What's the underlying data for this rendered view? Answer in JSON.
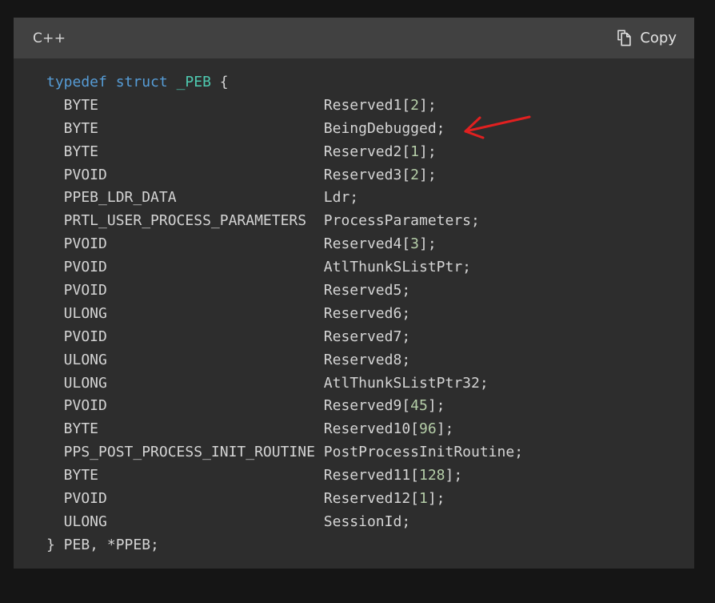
{
  "panel": {
    "language_label": "C++",
    "copy_label": "Copy",
    "copy_icon": "copy-documents-icon"
  },
  "colors": {
    "page_background": "#151515",
    "panel_background": "#2d2d2d",
    "header_background": "#414141",
    "default_text": "#d4d4d4",
    "keyword": "#569cd6",
    "type_name": "#4ec9b0",
    "number": "#b5cea8",
    "annotation_arrow": "#e02020"
  },
  "annotation": {
    "type": "arrow",
    "points_to": "BeingDebugged;",
    "color": "#e02020",
    "direction": "right-to-left"
  },
  "code": {
    "language": "C++",
    "lines": [
      {
        "segments": [
          {
            "t": "typedef ",
            "c": "kw"
          },
          {
            "t": "struct ",
            "c": "kw"
          },
          {
            "t": "_PEB",
            "c": "typ"
          },
          {
            "t": " {",
            "c": "plain"
          }
        ]
      },
      {
        "segments": [
          {
            "t": "  BYTE                          Reserved1[",
            "c": "plain"
          },
          {
            "t": "2",
            "c": "num"
          },
          {
            "t": "];",
            "c": "plain"
          }
        ]
      },
      {
        "segments": [
          {
            "t": "  BYTE                          BeingDebugged;",
            "c": "plain"
          }
        ]
      },
      {
        "segments": [
          {
            "t": "  BYTE                          Reserved2[",
            "c": "plain"
          },
          {
            "t": "1",
            "c": "num"
          },
          {
            "t": "];",
            "c": "plain"
          }
        ]
      },
      {
        "segments": [
          {
            "t": "  PVOID                         Reserved3[",
            "c": "plain"
          },
          {
            "t": "2",
            "c": "num"
          },
          {
            "t": "];",
            "c": "plain"
          }
        ]
      },
      {
        "segments": [
          {
            "t": "  PPEB_LDR_DATA                 Ldr;",
            "c": "plain"
          }
        ]
      },
      {
        "segments": [
          {
            "t": "  PRTL_USER_PROCESS_PARAMETERS  ProcessParameters;",
            "c": "plain"
          }
        ]
      },
      {
        "segments": [
          {
            "t": "  PVOID                         Reserved4[",
            "c": "plain"
          },
          {
            "t": "3",
            "c": "num"
          },
          {
            "t": "];",
            "c": "plain"
          }
        ]
      },
      {
        "segments": [
          {
            "t": "  PVOID                         AtlThunkSListPtr;",
            "c": "plain"
          }
        ]
      },
      {
        "segments": [
          {
            "t": "  PVOID                         Reserved5;",
            "c": "plain"
          }
        ]
      },
      {
        "segments": [
          {
            "t": "  ULONG                         Reserved6;",
            "c": "plain"
          }
        ]
      },
      {
        "segments": [
          {
            "t": "  PVOID                         Reserved7;",
            "c": "plain"
          }
        ]
      },
      {
        "segments": [
          {
            "t": "  ULONG                         Reserved8;",
            "c": "plain"
          }
        ]
      },
      {
        "segments": [
          {
            "t": "  ULONG                         AtlThunkSListPtr32;",
            "c": "plain"
          }
        ]
      },
      {
        "segments": [
          {
            "t": "  PVOID                         Reserved9[",
            "c": "plain"
          },
          {
            "t": "45",
            "c": "num"
          },
          {
            "t": "];",
            "c": "plain"
          }
        ]
      },
      {
        "segments": [
          {
            "t": "  BYTE                          Reserved10[",
            "c": "plain"
          },
          {
            "t": "96",
            "c": "num"
          },
          {
            "t": "];",
            "c": "plain"
          }
        ]
      },
      {
        "segments": [
          {
            "t": "  PPS_POST_PROCESS_INIT_ROUTINE PostProcessInitRoutine;",
            "c": "plain"
          }
        ]
      },
      {
        "segments": [
          {
            "t": "  BYTE                          Reserved11[",
            "c": "plain"
          },
          {
            "t": "128",
            "c": "num"
          },
          {
            "t": "];",
            "c": "plain"
          }
        ]
      },
      {
        "segments": [
          {
            "t": "  PVOID                         Reserved12[",
            "c": "plain"
          },
          {
            "t": "1",
            "c": "num"
          },
          {
            "t": "];",
            "c": "plain"
          }
        ]
      },
      {
        "segments": [
          {
            "t": "  ULONG                         SessionId;",
            "c": "plain"
          }
        ]
      },
      {
        "segments": [
          {
            "t": "} PEB, *PPEB;",
            "c": "plain"
          }
        ]
      }
    ]
  }
}
